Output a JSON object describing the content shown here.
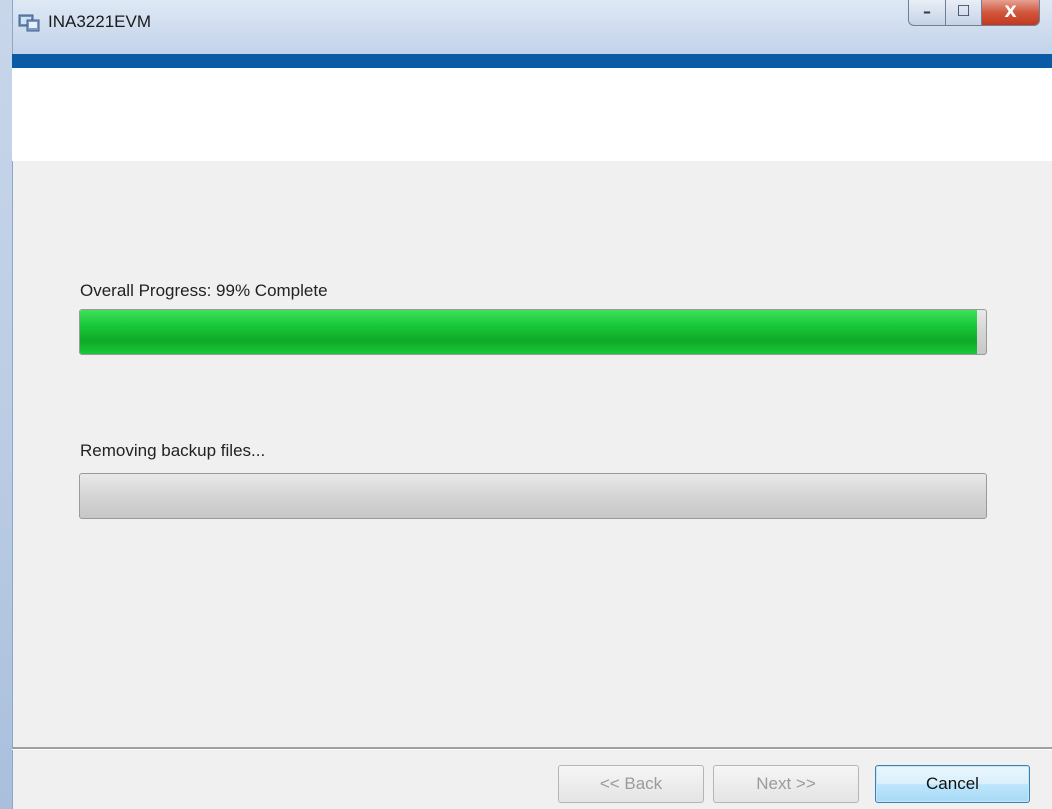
{
  "window": {
    "title": "INA3221EVM",
    "controls": {
      "minimize": "–",
      "maximize": "☐",
      "close": "X"
    }
  },
  "progress": {
    "overall_label": "Overall Progress: 99% Complete",
    "overall_value": 0.99,
    "status_label": "Removing backup files...",
    "status_value": 0.0
  },
  "footer": {
    "back_label": "<< Back",
    "next_label": "Next >>",
    "cancel_label": "Cancel"
  },
  "colors": {
    "progress_green": "#19c83a",
    "header_band": "#0b5aa6"
  }
}
